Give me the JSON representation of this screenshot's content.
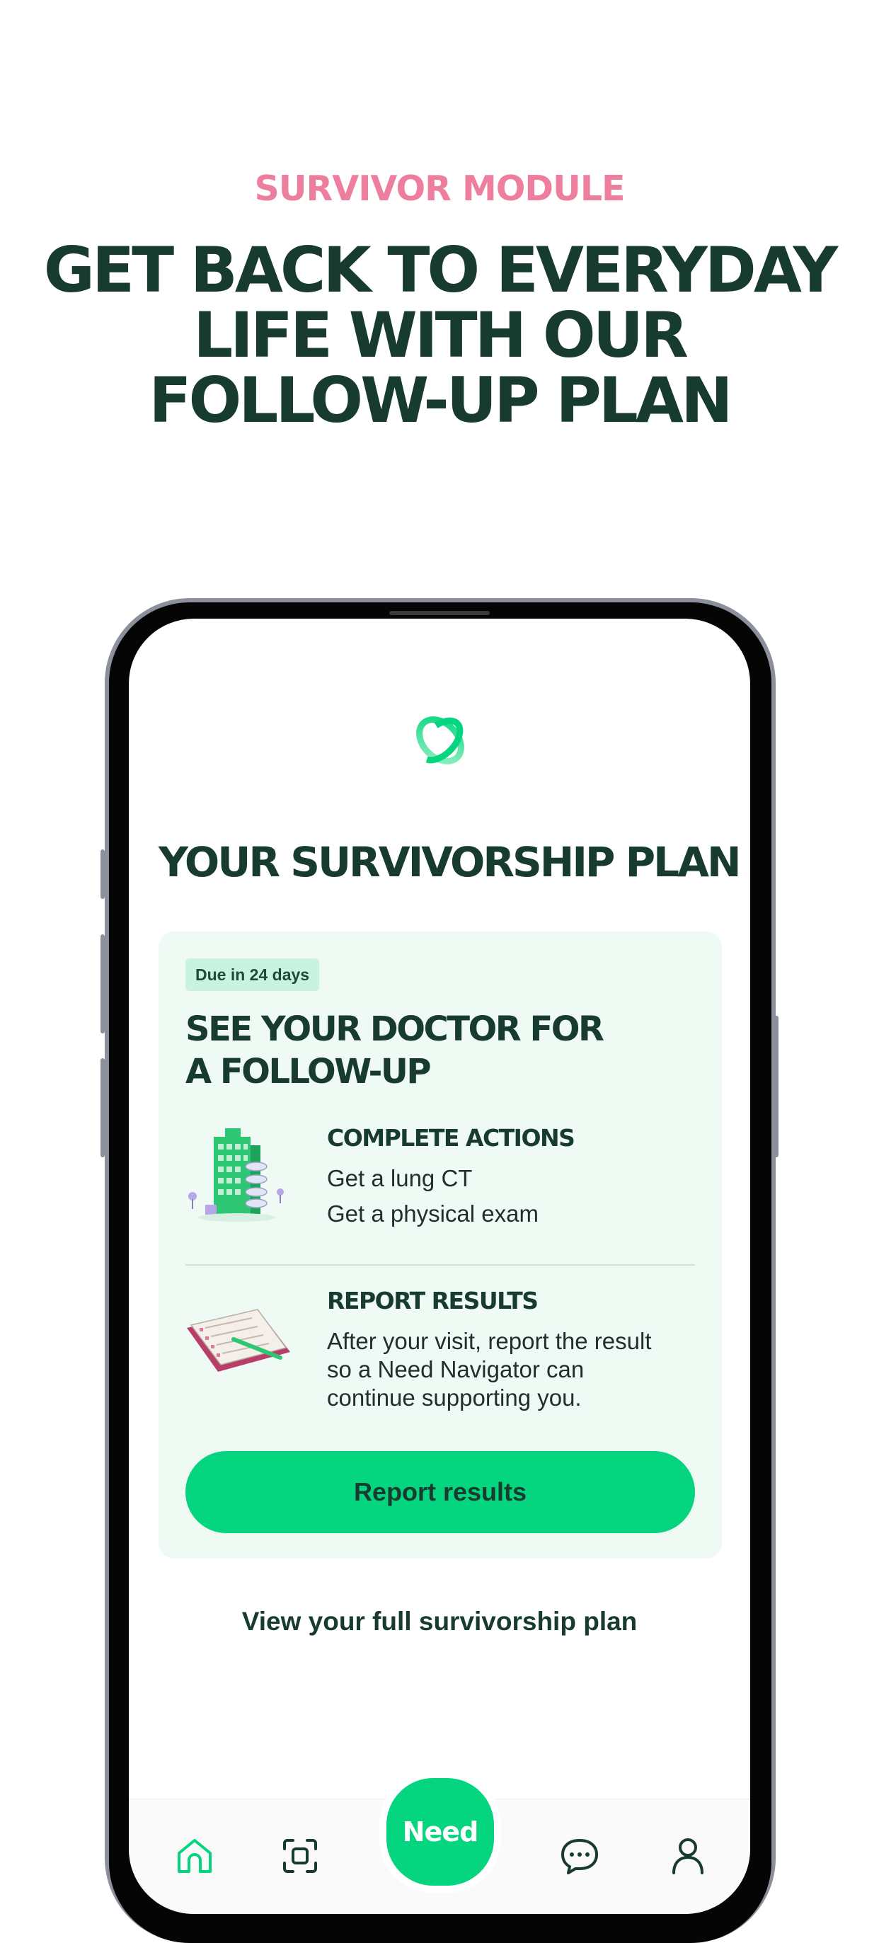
{
  "marketing": {
    "eyebrow": "SURVIVOR MODULE",
    "headline_lines": [
      "GET BACK TO EVERYDAY",
      "LIFE WITH OUR",
      "FOLLOW-UP PLAN"
    ]
  },
  "app": {
    "logo_icon": "need-logo-icon",
    "plan_title": "YOUR SURVIVORSHIP PLAN",
    "card": {
      "due_badge": "Due in 24 days",
      "title_lines": [
        "SEE YOUR DOCTOR FOR",
        "A FOLLOW-UP"
      ],
      "actions": {
        "heading": "COMPLETE ACTIONS",
        "items": [
          "Get a lung CT",
          "Get a physical exam"
        ],
        "icon": "hospital-building-illustration"
      },
      "report": {
        "heading": "REPORT RESULTS",
        "lines": [
          "After your visit, report the result",
          "so a Need Navigator can",
          "continue supporting you."
        ],
        "icon": "clipboard-checklist-illustration"
      },
      "cta_label": "Report results"
    },
    "view_link": "View your full survivorship plan",
    "nav": {
      "items": [
        {
          "icon": "home-icon",
          "active": true
        },
        {
          "icon": "scan-icon",
          "active": false
        },
        {
          "icon": "chat-icon",
          "active": false
        },
        {
          "icon": "profile-icon",
          "active": false
        }
      ],
      "center_label": "Need"
    }
  },
  "colors": {
    "accent_green": "#05d57e",
    "dark_green": "#183b2f",
    "pink": "#ee7e9d",
    "card_bg": "#effaf5",
    "badge_bg": "#c9f3de"
  }
}
